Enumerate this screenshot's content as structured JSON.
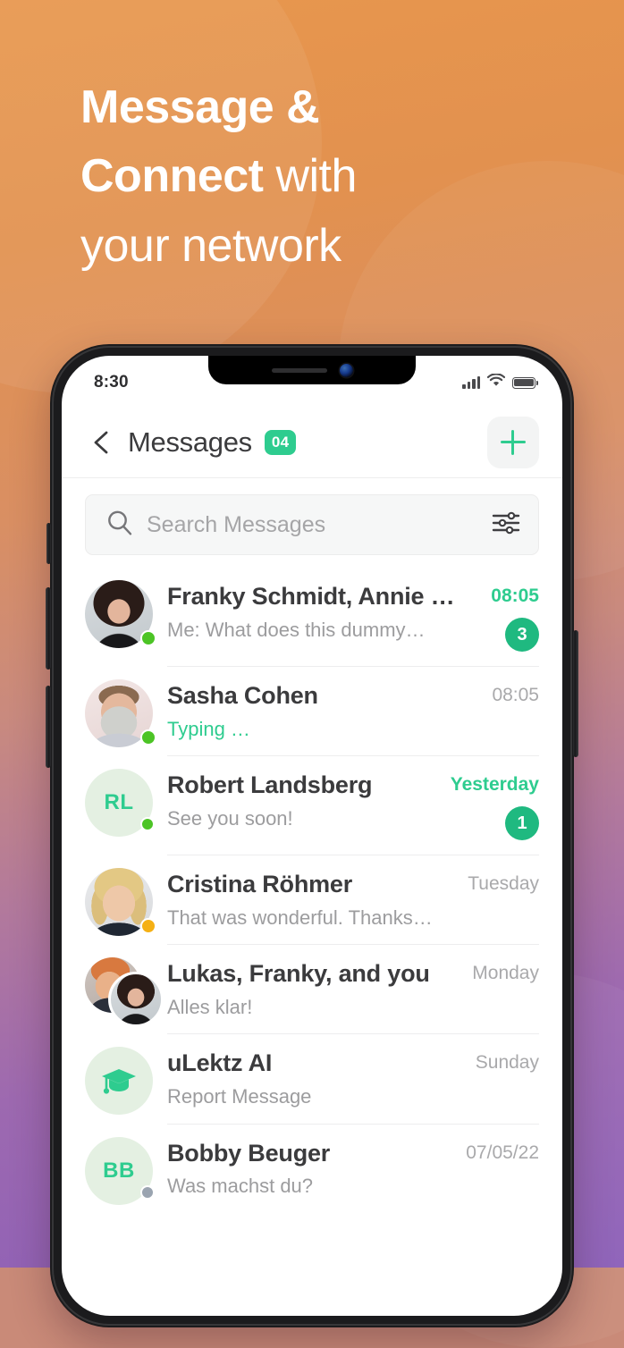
{
  "promo": {
    "headline_line1_bold": "Message &",
    "headline_line2_bold": "Connect",
    "headline_line2_rest": " with",
    "headline_line3": "your network",
    "bg_orange": "#e8974e",
    "bg_purple": "#8c5fb8"
  },
  "status_bar": {
    "time": "8:30",
    "icons": [
      "signal-icon",
      "wifi-icon",
      "battery-icon"
    ]
  },
  "header": {
    "back_icon": "chevron-left-icon",
    "title": "Messages",
    "count_badge": "04",
    "add_icon": "plus-icon",
    "accent": "#2ecc8f"
  },
  "search": {
    "placeholder": "Search Messages",
    "value": "",
    "search_icon": "search-icon",
    "filter_icon": "sliders-icon"
  },
  "conversations": [
    {
      "name": "Franky Schmidt, Annie …",
      "preview": "Me: What does this dummy…",
      "time": "08:05",
      "time_unread": true,
      "unread": "3",
      "avatar_type": "photo",
      "avatar_class": "ph-franky",
      "status": "online",
      "typing": false
    },
    {
      "name": "Sasha Cohen",
      "preview": "Typing …",
      "time": "08:05",
      "time_unread": false,
      "unread": "",
      "avatar_type": "photo",
      "avatar_class": "ph-sasha",
      "status": "online",
      "typing": true
    },
    {
      "name": "Robert Landsberg",
      "preview": "See you soon!",
      "time": "Yesterday",
      "time_unread": true,
      "unread": "1",
      "avatar_type": "initials",
      "initials": "RL",
      "status": "online",
      "typing": false
    },
    {
      "name": "Cristina Röhmer",
      "preview": "That was wonderful. Thanks…",
      "time": "Tuesday",
      "time_unread": false,
      "unread": "",
      "avatar_type": "photo",
      "avatar_class": "ph-cristina",
      "status": "away",
      "typing": false
    },
    {
      "name": "Lukas, Franky, and you",
      "preview": "Alles klar!",
      "time": "Monday",
      "time_unread": false,
      "unread": "",
      "avatar_type": "stack",
      "status": "none",
      "typing": false
    },
    {
      "name": "uLektz AI",
      "preview": "Report Message",
      "time": "Sunday",
      "time_unread": false,
      "unread": "",
      "avatar_type": "icon",
      "avatar_icon": "graduation-cap-icon",
      "status": "none",
      "typing": false
    },
    {
      "name": "Bobby Beuger",
      "preview": "Was machst du?",
      "time": "07/05/22",
      "time_unread": false,
      "unread": "",
      "avatar_type": "initials",
      "initials": "BB",
      "status": "offline",
      "typing": false
    }
  ]
}
